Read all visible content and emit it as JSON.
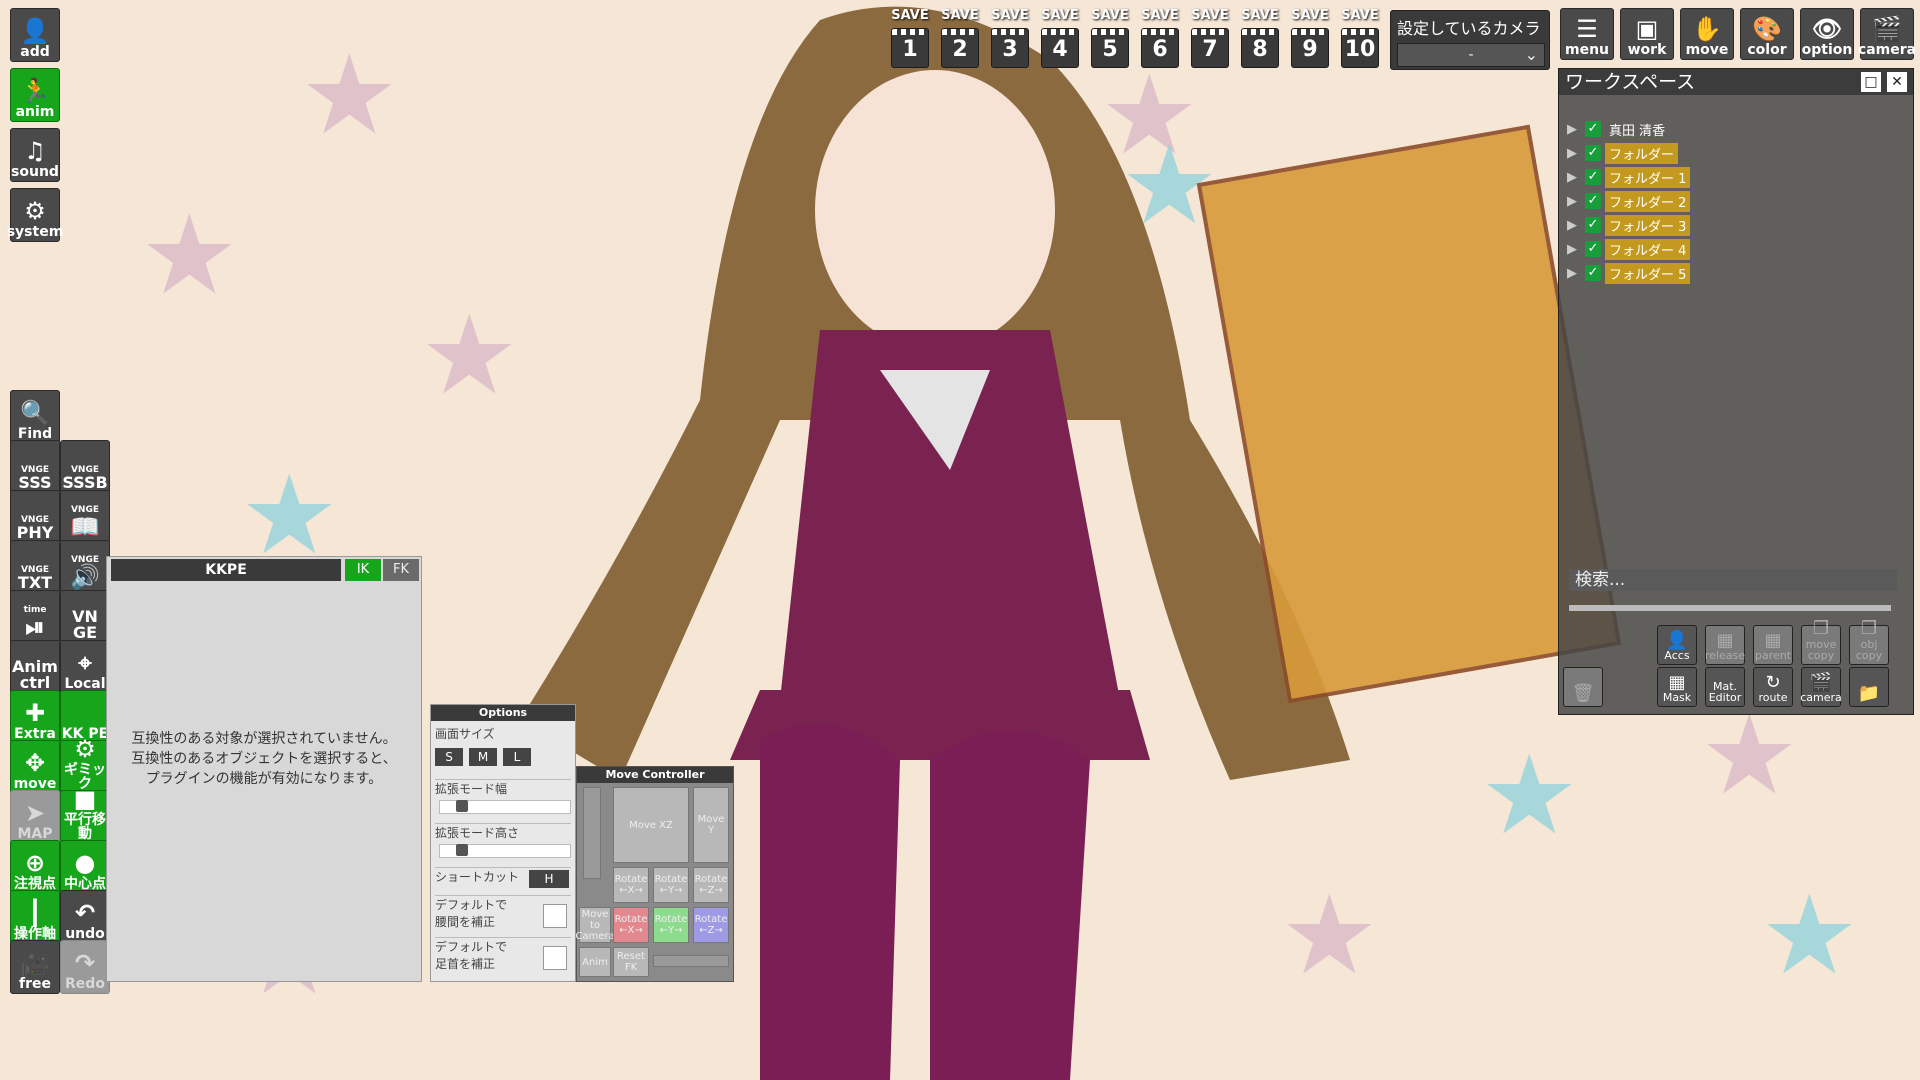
{
  "left_toolbar": {
    "top": [
      {
        "name": "add-button",
        "label": "add",
        "icon": "person-icon",
        "glyph": "👤",
        "style": "dark"
      },
      {
        "name": "anim-button",
        "label": "anim",
        "icon": "running-figure-icon",
        "glyph": "🏃",
        "style": "green"
      },
      {
        "name": "sound-button",
        "label": "sound",
        "icon": "music-note-icon",
        "glyph": "♫",
        "style": "dark"
      },
      {
        "name": "system-button",
        "label": "system",
        "icon": "gears-icon",
        "glyph": "⚙",
        "style": "dark"
      }
    ],
    "grid": [
      {
        "name": "find-button",
        "label": "Find",
        "icon": "magnifier-icon",
        "glyph": "🔍",
        "style": "dark"
      },
      {
        "name": "vnge-sss-button",
        "small": "VNGE",
        "label": "SSS",
        "style": "vn"
      },
      {
        "name": "vnge-sssb-button",
        "small": "VNGE",
        "label": "SSSB",
        "style": "vn"
      },
      {
        "name": "vnge-phy-button",
        "small": "VNGE",
        "label": "PHY",
        "style": "vn"
      },
      {
        "name": "vnge-book-button",
        "small": "VNGE",
        "label": "",
        "icon": "book-icon",
        "glyph": "📖",
        "style": "vn"
      },
      {
        "name": "vnge-txt-button",
        "small": "VNGE",
        "label": "TXT",
        "style": "vn"
      },
      {
        "name": "vnge-speaker-button",
        "small": "VNGE",
        "label": "",
        "icon": "speaker-icon",
        "glyph": "🔊",
        "style": "vn"
      },
      {
        "name": "time-button",
        "small": "time",
        "label": "",
        "icon": "play-pause-icon",
        "glyph": "⏯",
        "style": "vn"
      },
      {
        "name": "vn-ge-button",
        "small": "",
        "label": "VN GE",
        "style": "vn"
      },
      {
        "name": "anim-ctrl-button",
        "small": "",
        "label": "Anim ctrl",
        "style": "vn"
      },
      {
        "name": "local-button",
        "label": "Local",
        "icon": "axes-icon",
        "glyph": "⌖",
        "style": "dark"
      },
      {
        "name": "extra-button",
        "label": "Extra",
        "icon": "plus-figure-icon",
        "glyph": "✚",
        "style": "green"
      },
      {
        "name": "kkpe-button",
        "label": "KK PE",
        "style": "green"
      },
      {
        "name": "move-button",
        "label": "move",
        "icon": "move-arrows-icon",
        "glyph": "✥",
        "style": "green"
      },
      {
        "name": "gimmick-button",
        "label": "ギミック",
        "icon": "gear-icon",
        "glyph": "⚙",
        "style": "green"
      },
      {
        "name": "map-button",
        "label": "MAP",
        "icon": "map-pointer-icon",
        "glyph": "➤",
        "style": "dim"
      },
      {
        "name": "parallel-move-button",
        "label": "平行移動",
        "icon": "square-icon",
        "glyph": "■",
        "style": "green"
      },
      {
        "name": "gaze-point-button",
        "label": "注視点",
        "icon": "plus-circle-icon",
        "glyph": "⊕",
        "style": "green"
      },
      {
        "name": "center-point-button",
        "label": "中心点",
        "icon": "circle-icon",
        "glyph": "●",
        "style": "green"
      },
      {
        "name": "operation-axis-button",
        "label": "操作軸",
        "icon": "axis-icon",
        "glyph": "┃",
        "style": "green"
      },
      {
        "name": "undo-button",
        "label": "undo",
        "icon": "undo-arrow-icon",
        "glyph": "↶",
        "style": "dark"
      },
      {
        "name": "free-camera-button",
        "label": "free",
        "icon": "video-camera-icon",
        "glyph": "🎥",
        "style": "dark"
      },
      {
        "name": "redo-button",
        "label": "Redo",
        "icon": "redo-arrow-icon",
        "glyph": "↷",
        "style": "dim"
      }
    ]
  },
  "save_bar": {
    "label": "SAVE",
    "slots": [
      "1",
      "2",
      "3",
      "4",
      "5",
      "6",
      "7",
      "8",
      "9",
      "10"
    ]
  },
  "camera": {
    "label": "設定しているカメラ",
    "value": "-"
  },
  "top_menu": [
    {
      "name": "menu-button",
      "label": "menu",
      "icon": "list-icon",
      "glyph": "☰"
    },
    {
      "name": "work-button",
      "label": "work",
      "icon": "window-icon",
      "glyph": "▣"
    },
    {
      "name": "move-hand-button",
      "label": "move",
      "icon": "hand-icon",
      "glyph": "✋"
    },
    {
      "name": "color-button",
      "label": "color",
      "icon": "palette-icon",
      "glyph": "🎨"
    },
    {
      "name": "option-button",
      "label": "option",
      "icon": "eye-icon",
      "glyph": "👁"
    },
    {
      "name": "camera-button",
      "label": "camera",
      "icon": "clapper-icon",
      "glyph": "🎬"
    }
  ],
  "workspace": {
    "title": "ワークスペース",
    "items": [
      {
        "label": "真田 清香",
        "folder": false
      },
      {
        "label": "フォルダー",
        "folder": true
      },
      {
        "label": "フォルダー 1",
        "folder": true
      },
      {
        "label": "フォルダー 2",
        "folder": true
      },
      {
        "label": "フォルダー 3",
        "folder": true
      },
      {
        "label": "フォルダー 4",
        "folder": true
      },
      {
        "label": "フォルダー 5",
        "folder": true
      }
    ],
    "search_placeholder": "検索...",
    "tools_row1": [
      {
        "name": "accs-button",
        "label": "Accs",
        "icon": "person-icon",
        "dim": false
      },
      {
        "name": "release-button",
        "label": "release",
        "icon": "grid-icon",
        "dim": true
      },
      {
        "name": "parent-button",
        "label": "parent",
        "icon": "grid-icon",
        "dim": true
      },
      {
        "name": "move-copy-button",
        "label": "move copy",
        "icon": "copy-icon",
        "dim": true
      },
      {
        "name": "obj-copy-button",
        "label": "obj copy",
        "icon": "copy-icon",
        "dim": true
      }
    ],
    "tools_row2": [
      {
        "name": "delete-button",
        "label": "",
        "icon": "trash-icon",
        "dim": true
      },
      {
        "name": "mask-button",
        "label": "Mask",
        "icon": "grid-icon",
        "dim": false
      },
      {
        "name": "mat-editor-button",
        "label": "Mat. Editor",
        "icon": "",
        "dim": false
      },
      {
        "name": "route-button",
        "label": "route",
        "icon": "route-icon",
        "dim": false
      },
      {
        "name": "ws-camera-button",
        "label": "camera",
        "icon": "clapper-icon",
        "dim": false
      },
      {
        "name": "folder-button",
        "label": "",
        "icon": "folder-icon",
        "dim": false
      }
    ]
  },
  "kkpe": {
    "title": "KKPE",
    "ik": "IK",
    "fk": "FK",
    "message_line1": "互換性のある対象が選択されていません。",
    "message_line2": "互換性のあるオブジェクトを選択すると、",
    "message_line3": "プラグインの機能が有効になります。"
  },
  "options": {
    "title": "Options",
    "screen_size_label": "画面サイズ",
    "sizes": [
      "S",
      "M",
      "L"
    ],
    "expand_width_label": "拡張モード幅",
    "expand_height_label": "拡張モード高さ",
    "expand_width_value": 0.1,
    "expand_height_value": 0.1,
    "shortcut_label": "ショートカット",
    "shortcut_key": "H",
    "default_hip_line1": "デフォルトで",
    "default_hip_line2": "腰間を補正",
    "default_foot_line1": "デフォルトで",
    "default_foot_line2": "足首を補正"
  },
  "move_controller": {
    "title": "Move Controller",
    "move_xz": "Move XZ",
    "move_y": "Move Y",
    "rotate_x": "Rotate ←X→",
    "rotate_y": "Rotate ←Y→",
    "rotate_z": "Rotate ←Z→",
    "move_to_camera": "Move to Camera",
    "anim": "Anim",
    "reset_fk": "Reset FK"
  },
  "colors": {
    "toolbar_green": "#17a51c",
    "folder_yellow": "#c39a1f",
    "check_green": "#1a9e3c"
  }
}
